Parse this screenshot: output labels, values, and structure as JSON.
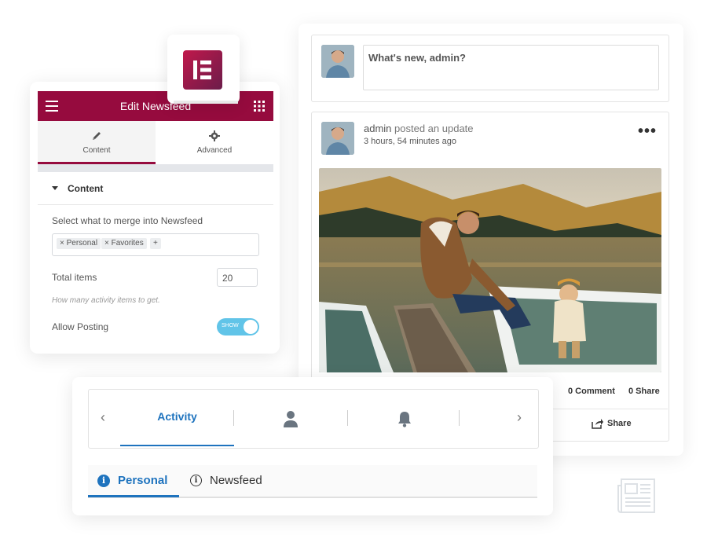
{
  "feed": {
    "composer_placeholder": "What's new, admin?",
    "post": {
      "author": "admin",
      "action": " posted an update",
      "time": "3 hours, 54 minutes ago",
      "more_label": "•••",
      "comment_count": "0 Comment",
      "share_count": "0 Share",
      "share_label": "Share"
    }
  },
  "editor": {
    "title": "Edit Newsfeed",
    "tabs": [
      {
        "label": "Content",
        "icon": "pencil-icon"
      },
      {
        "label": "Advanced",
        "icon": "gear-icon"
      }
    ],
    "section_title": "Content",
    "merge_label": "Select what to merge into Newsfeed",
    "tags": [
      "Personal",
      "Favorites"
    ],
    "tag_remove": "×",
    "tag_add": "+",
    "total_items_label": "Total items",
    "total_items_value": "20",
    "total_items_hint": "How many activity items to get.",
    "allow_posting_label": "Allow Posting",
    "allow_posting_toggle": "SHOW",
    "allow_posting_on": true
  },
  "widget": {
    "tabs": [
      "Activity",
      "profile-icon",
      "bell-icon"
    ],
    "active_tab": "Activity",
    "prev_arrow": "‹",
    "next_arrow": "›",
    "subnav": [
      {
        "label": "Personal",
        "active": true
      },
      {
        "label": "Newsfeed",
        "active": false
      }
    ]
  },
  "colors": {
    "brand": "#960b3e",
    "accent_blue": "#1e73be",
    "toggle_on": "#61c4e8"
  }
}
